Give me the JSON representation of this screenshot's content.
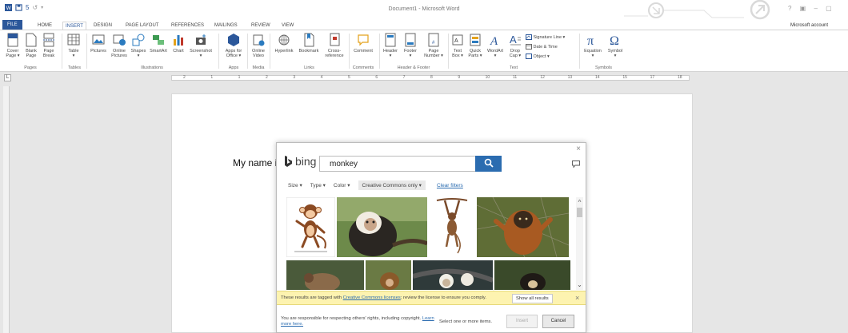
{
  "window": {
    "title": "Document1 - Microsoft Word",
    "help_controls": "? ▣ – ▢",
    "account": "Microsoft account",
    "qat_undo": "5",
    "qat_redo": "↺"
  },
  "tabs": [
    "FILE",
    "HOME",
    "INSERT",
    "DESIGN",
    "PAGE LAYOUT",
    "REFERENCES",
    "MAILINGS",
    "REVIEW",
    "VIEW"
  ],
  "ribbon": {
    "pages": {
      "cover": "Cover\nPage ▾",
      "blank": "Blank\nPage",
      "break": "Page\nBreak",
      "label": "Pages"
    },
    "tables": {
      "table": "Table\n▾",
      "label": "Tables"
    },
    "illustrations": {
      "pictures": "Pictures",
      "online_pictures": "Online\nPictures",
      "shapes": "Shapes\n▾",
      "smartart": "SmartArt",
      "chart": "Chart",
      "screenshot": "Screenshot\n▾",
      "label": "Illustrations"
    },
    "apps": {
      "apps_for_office": "Apps for\nOffice ▾",
      "label": "Apps"
    },
    "media": {
      "online_video": "Online\nVideo",
      "label": "Media"
    },
    "links": {
      "hyperlink": "Hyperlink",
      "bookmark": "Bookmark",
      "cross_reference": "Cross-\nreference",
      "label": "Links"
    },
    "comments": {
      "comment": "Comment",
      "label": "Comments"
    },
    "header_footer": {
      "header": "Header\n▾",
      "footer": "Footer\n▾",
      "page_number": "Page\nNumber ▾",
      "label": "Header & Footer"
    },
    "text": {
      "text_box": "Text\nBox ▾",
      "quick_parts": "Quick\nParts ▾",
      "wordart": "WordArt\n▾",
      "drop_cap": "Drop\nCap ▾",
      "signature_line": "Signature Line ▾",
      "date_time": "Date & Time",
      "object": "Object ▾",
      "label": "Text"
    },
    "symbols": {
      "equation": "Equation\n▾",
      "symbol": "Symbol\n▾",
      "label": "Symbols"
    }
  },
  "ruler": {
    "numbers": [
      "2",
      "1",
      "1",
      "2",
      "3",
      "4",
      "5",
      "6",
      "7",
      "8",
      "9",
      "10",
      "11",
      "12",
      "13",
      "14",
      "15",
      "17",
      "18"
    ]
  },
  "document": {
    "text": "My name i"
  },
  "dialog": {
    "brand": "bing",
    "search_value": "monkey",
    "filters": {
      "size": "Size ▾",
      "type": "Type ▾",
      "color": "Color ▾",
      "license": "Creative Commons only ▾",
      "clear": "Clear filters"
    },
    "cc_notice": {
      "prefix": "These results are tagged with ",
      "link": "Creative Commons licenses",
      "suffix": "; review the license to ensure you comply.",
      "show_all": "Show all results"
    },
    "footer": {
      "responsibility": "You are responsible for respecting others' rights, including copyright. ",
      "learn_more": "Learn more here.",
      "select_hint": "Select one or more items.",
      "insert": "Insert",
      "cancel": "Cancel"
    },
    "thumbnails": [
      "cartoon-monkey",
      "capuchin-monkey",
      "hanging-monkey",
      "orangutan-like-monkey",
      "monkey-thumb-5",
      "monkey-thumb-6",
      "monkey-thumb-7",
      "monkey-thumb-8"
    ]
  },
  "colors": {
    "word_blue": "#2b579a",
    "bing_blue": "#2b6cb0",
    "notice_yellow": "#fdf3b0"
  }
}
